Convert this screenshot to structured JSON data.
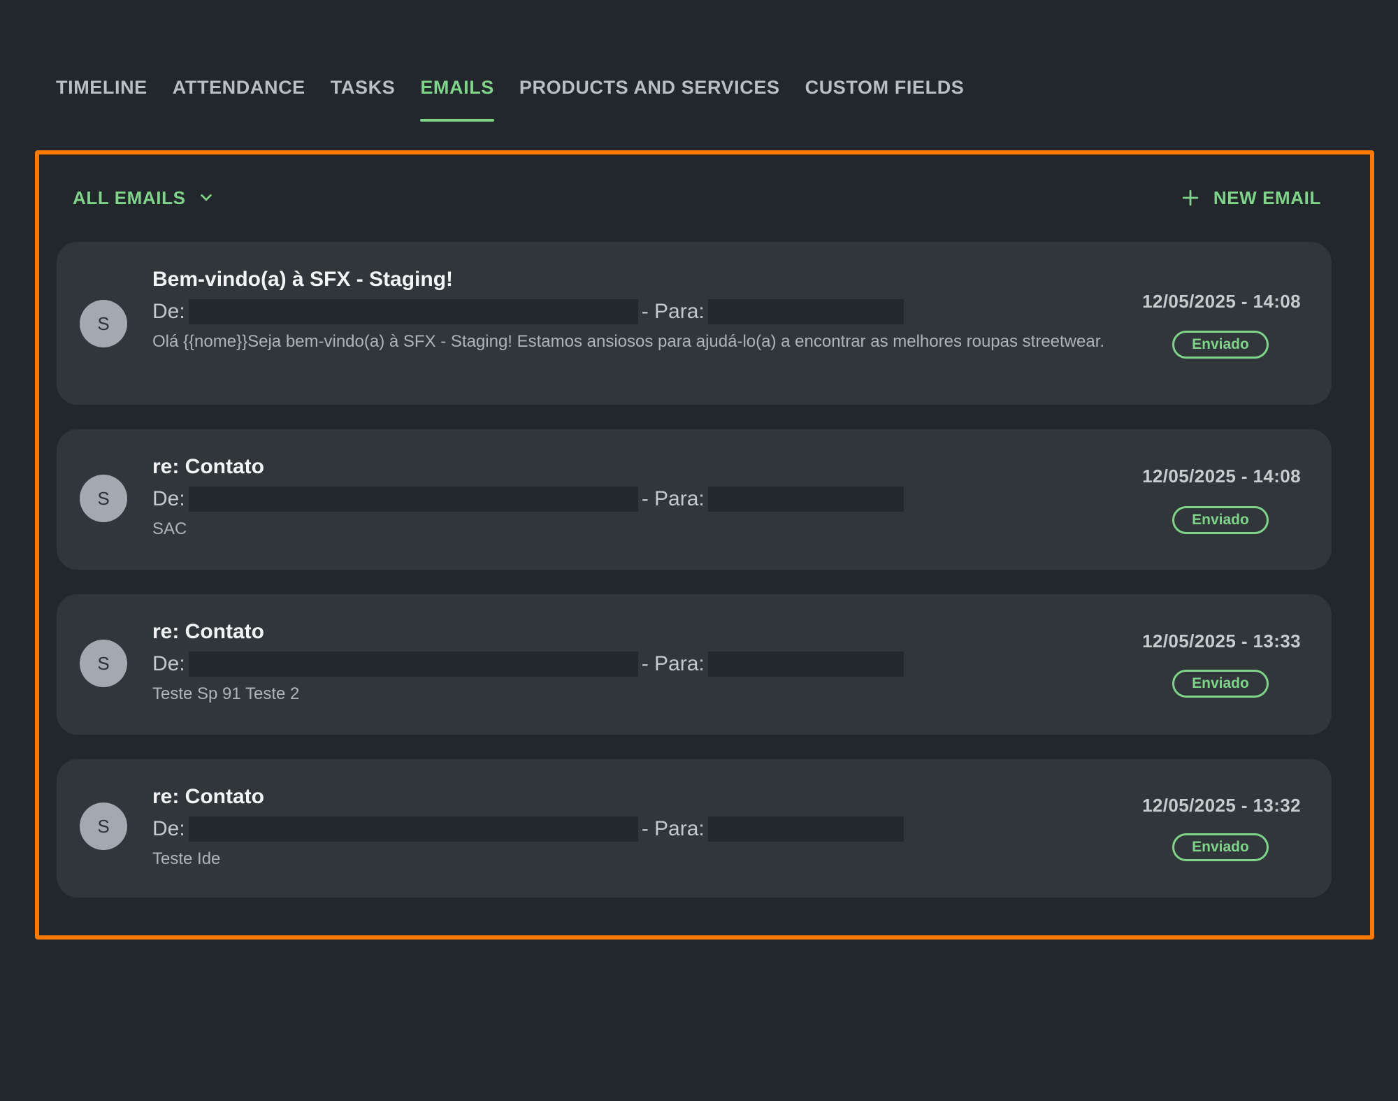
{
  "tabs": [
    {
      "label": "TIMELINE",
      "active": false
    },
    {
      "label": "ATTENDANCE",
      "active": false
    },
    {
      "label": "TASKS",
      "active": false
    },
    {
      "label": "EMAILS",
      "active": true
    },
    {
      "label": "PRODUCTS AND SERVICES",
      "active": false
    },
    {
      "label": "CUSTOM FIELDS",
      "active": false
    }
  ],
  "toolbar": {
    "filter_label": "ALL EMAILS",
    "filter_icon": "chevron-down-icon",
    "new_email_label": "NEW EMAIL",
    "new_email_icon": "plus-icon"
  },
  "labels": {
    "from": "De:",
    "to": "- Para:"
  },
  "emails": [
    {
      "avatar": "S",
      "subject": "Bem-vindo(a) à SFX - Staging!",
      "preview": "Olá {{nome}}Seja bem-vindo(a) à SFX - Staging! Estamos ansiosos para ajudá-lo(a) a encontrar as melhores roupas streetwear.",
      "date": "12/05/2025 - 14:08",
      "status": "Enviado"
    },
    {
      "avatar": "S",
      "subject": "re: Contato",
      "preview": "SAC",
      "date": "12/05/2025 - 14:08",
      "status": "Enviado"
    },
    {
      "avatar": "S",
      "subject": "re: Contato",
      "preview": "Teste Sp 91 Teste 2",
      "date": "12/05/2025 - 13:33",
      "status": "Enviado"
    },
    {
      "avatar": "S",
      "subject": "re: Contato",
      "preview": "Teste Ide",
      "date": "12/05/2025 - 13:32",
      "status": "Enviado"
    }
  ],
  "colors": {
    "background": "#21272b",
    "card": "#30363a",
    "accent": "#7fd48a",
    "highlight": "#ff7a00"
  }
}
